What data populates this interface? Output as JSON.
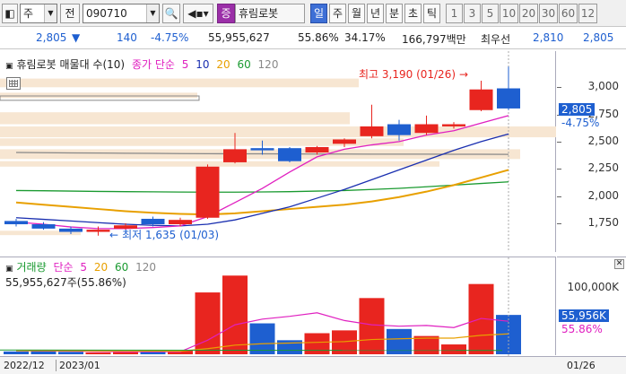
{
  "toolbar": {
    "market_type": "주",
    "prev_label": "전",
    "code": "090710",
    "market_badge": "증",
    "stock_name": "휴림로봇",
    "periods": [
      "일",
      "주",
      "월",
      "년",
      "분",
      "초",
      "틱"
    ],
    "active_period": "일",
    "intervals": [
      "1",
      "3",
      "5",
      "10",
      "20",
      "30",
      "60",
      "12"
    ]
  },
  "quote": {
    "price": "2,805",
    "direction": "▼",
    "change": "140",
    "change_pct": "-4.75%",
    "volume": "55,955,627",
    "volume_ratio": "55.86%",
    "turnover": "34.17%",
    "amount": "166,797백만",
    "bid_label": "최우선",
    "bid": "2,810",
    "ask": "2,805"
  },
  "price_panel": {
    "legend_title": "휴림로봇 매물대 수(10)",
    "ma_label": "종가 단순",
    "ma_periods": [
      "5",
      "10",
      "20",
      "60",
      "120"
    ],
    "high_note": "최고 3,190 (01/26)",
    "low_note": "최저 1,635 (01/03)",
    "current_price_tag": "2,805",
    "current_change_tag": "-4.75%",
    "axis_labels": [
      "3,000",
      "2,750",
      "2,500",
      "2,250",
      "2,000",
      "1,750"
    ]
  },
  "volume_panel": {
    "legend_title": "거래량",
    "ma_label": "단순",
    "ma_periods": [
      "5",
      "20",
      "60",
      "120"
    ],
    "summary": "55,955,627주(55.86%)",
    "axis_label": "100,000K",
    "current_tag": "55,956K",
    "current_pct": "55.86%"
  },
  "date_axis": {
    "labels": [
      "2022/12",
      "2023/01"
    ],
    "cursor_date": "01/26"
  },
  "colors": {
    "up": "#e8251f",
    "down": "#1e5fd0",
    "ma5": "#e020c0",
    "ma10": "#1a2fb0",
    "ma20": "#e8a000",
    "ma60": "#1a9a30",
    "ma120": "#888888",
    "profile": "#f7e6d2"
  },
  "chart_data": {
    "type": "candlestick",
    "y_range": [
      1600,
      3250
    ],
    "candles": [
      {
        "open": 1770,
        "close": 1740,
        "high": 1790,
        "low": 1720
      },
      {
        "open": 1740,
        "close": 1700,
        "high": 1760,
        "low": 1690
      },
      {
        "open": 1700,
        "close": 1670,
        "high": 1720,
        "low": 1650
      },
      {
        "open": 1670,
        "close": 1690,
        "high": 1720,
        "low": 1635
      },
      {
        "open": 1700,
        "close": 1730,
        "high": 1750,
        "low": 1690
      },
      {
        "open": 1790,
        "close": 1740,
        "high": 1810,
        "low": 1720
      },
      {
        "open": 1740,
        "close": 1780,
        "high": 1800,
        "low": 1720
      },
      {
        "open": 1800,
        "close": 2270,
        "high": 2290,
        "low": 1790
      },
      {
        "open": 2310,
        "close": 2430,
        "high": 2580,
        "low": 2300
      },
      {
        "open": 2440,
        "close": 2420,
        "high": 2510,
        "low": 2380
      },
      {
        "open": 2440,
        "close": 2320,
        "high": 2450,
        "low": 2310
      },
      {
        "open": 2400,
        "close": 2450,
        "high": 2460,
        "low": 2380
      },
      {
        "open": 2480,
        "close": 2520,
        "high": 2530,
        "low": 2450
      },
      {
        "open": 2550,
        "close": 2640,
        "high": 2840,
        "low": 2530
      },
      {
        "open": 2660,
        "close": 2560,
        "high": 2700,
        "low": 2510
      },
      {
        "open": 2580,
        "close": 2660,
        "high": 2740,
        "low": 2560
      },
      {
        "open": 2640,
        "close": 2660,
        "high": 2680,
        "low": 2620
      },
      {
        "open": 2790,
        "close": 2980,
        "high": 3060,
        "low": 2780
      },
      {
        "open": 2990,
        "close": 2805,
        "high": 3190,
        "low": 2790
      }
    ],
    "ma5": [
      1760,
      1740,
      1715,
      1700,
      1700,
      1710,
      1725,
      1810,
      1940,
      2070,
      2220,
      2360,
      2430,
      2470,
      2500,
      2560,
      2600,
      2670,
      2740
    ],
    "ma10": [
      1800,
      1785,
      1770,
      1755,
      1740,
      1730,
      1725,
      1740,
      1780,
      1840,
      1900,
      1980,
      2060,
      2150,
      2240,
      2330,
      2420,
      2500,
      2570
    ],
    "ma20": [
      1940,
      1920,
      1900,
      1880,
      1860,
      1845,
      1835,
      1830,
      1840,
      1860,
      1880,
      1900,
      1920,
      1950,
      1990,
      2040,
      2100,
      2170,
      2240
    ],
    "ma60": [
      2050,
      2048,
      2045,
      2042,
      2040,
      2038,
      2036,
      2035,
      2035,
      2037,
      2040,
      2045,
      2050,
      2060,
      2070,
      2085,
      2100,
      2115,
      2130
    ],
    "ma120": [
      2400,
      2398,
      2396,
      2395,
      2393,
      2392,
      2390,
      2389,
      2388,
      2388,
      2387,
      2386,
      2386,
      2385,
      2385,
      2385,
      2384,
      2384,
      2383
    ],
    "volume": [
      4000,
      5000,
      3500,
      2500,
      3000,
      4000,
      5000,
      88000,
      112000,
      44000,
      20000,
      30000,
      34000,
      80000,
      36000,
      26000,
      14000,
      100000,
      56000
    ],
    "vol_ma5": [
      5000,
      4800,
      4500,
      4000,
      3600,
      3600,
      3600,
      20000,
      42000,
      50000,
      54000,
      59000,
      48000,
      42000,
      40000,
      41000,
      38000,
      51000,
      47000
    ],
    "vol_ma20": [
      5000,
      5000,
      4900,
      4800,
      4700,
      4600,
      4500,
      8000,
      13000,
      15000,
      16000,
      17000,
      18000,
      21000,
      22000,
      23000,
      23000,
      27000,
      29000
    ],
    "vol_max": 120000
  }
}
